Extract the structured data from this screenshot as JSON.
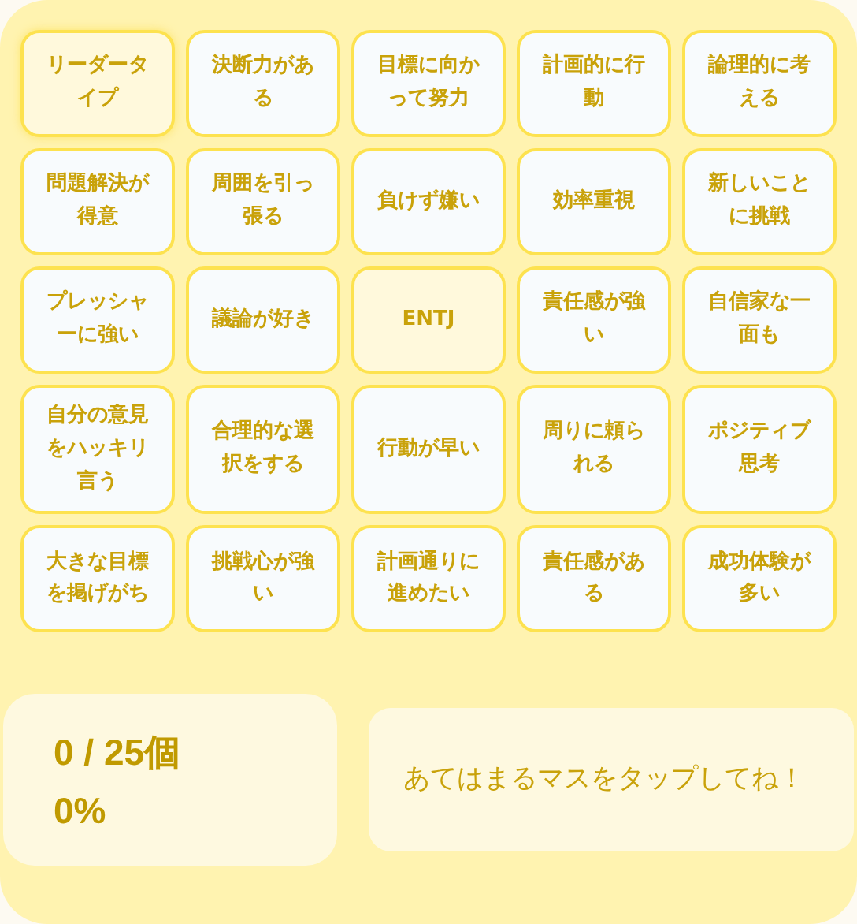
{
  "cells": [
    {
      "label": "リーダータイプ",
      "kind": "normal",
      "highlighted": true
    },
    {
      "label": "決断力がある",
      "kind": "normal",
      "highlighted": false
    },
    {
      "label": "目標に向かって努力",
      "kind": "normal",
      "highlighted": false
    },
    {
      "label": "計画的に行動",
      "kind": "normal",
      "highlighted": false
    },
    {
      "label": "論理的に考える",
      "kind": "normal",
      "highlighted": false
    },
    {
      "label": "問題解決が得意",
      "kind": "normal",
      "highlighted": false
    },
    {
      "label": "周囲を引っ張る",
      "kind": "normal",
      "highlighted": false
    },
    {
      "label": "負けず嫌い",
      "kind": "normal",
      "highlighted": false
    },
    {
      "label": "効率重視",
      "kind": "normal",
      "highlighted": false
    },
    {
      "label": "新しいことに挑戦",
      "kind": "normal",
      "highlighted": false
    },
    {
      "label": "プレッシャーに強い",
      "kind": "normal",
      "highlighted": false
    },
    {
      "label": "議論が好き",
      "kind": "normal",
      "highlighted": false
    },
    {
      "label": "ENTJ",
      "kind": "free",
      "highlighted": false
    },
    {
      "label": "責任感が強い",
      "kind": "normal",
      "highlighted": false
    },
    {
      "label": "自信家な一面も",
      "kind": "normal",
      "highlighted": false
    },
    {
      "label": "自分の意見をハッキリ言う",
      "kind": "normal",
      "highlighted": false
    },
    {
      "label": "合理的な選択をする",
      "kind": "normal",
      "highlighted": false
    },
    {
      "label": "行動が早い",
      "kind": "normal",
      "highlighted": false
    },
    {
      "label": "周りに頼られる",
      "kind": "normal",
      "highlighted": false
    },
    {
      "label": "ポジティブ思考",
      "kind": "normal",
      "highlighted": false
    },
    {
      "label": "大きな目標を掲げがち",
      "kind": "normal",
      "highlighted": false
    },
    {
      "label": "挑戦心が強い",
      "kind": "normal",
      "highlighted": false
    },
    {
      "label": "計画通りに進めたい",
      "kind": "normal",
      "highlighted": false
    },
    {
      "label": "責任感がある",
      "kind": "normal",
      "highlighted": false
    },
    {
      "label": "成功体験が多い",
      "kind": "normal",
      "highlighted": false
    }
  ],
  "stats": {
    "count": "0 / 25個",
    "percent": "0%"
  },
  "message": "あてはまるマスをタップしてね！"
}
